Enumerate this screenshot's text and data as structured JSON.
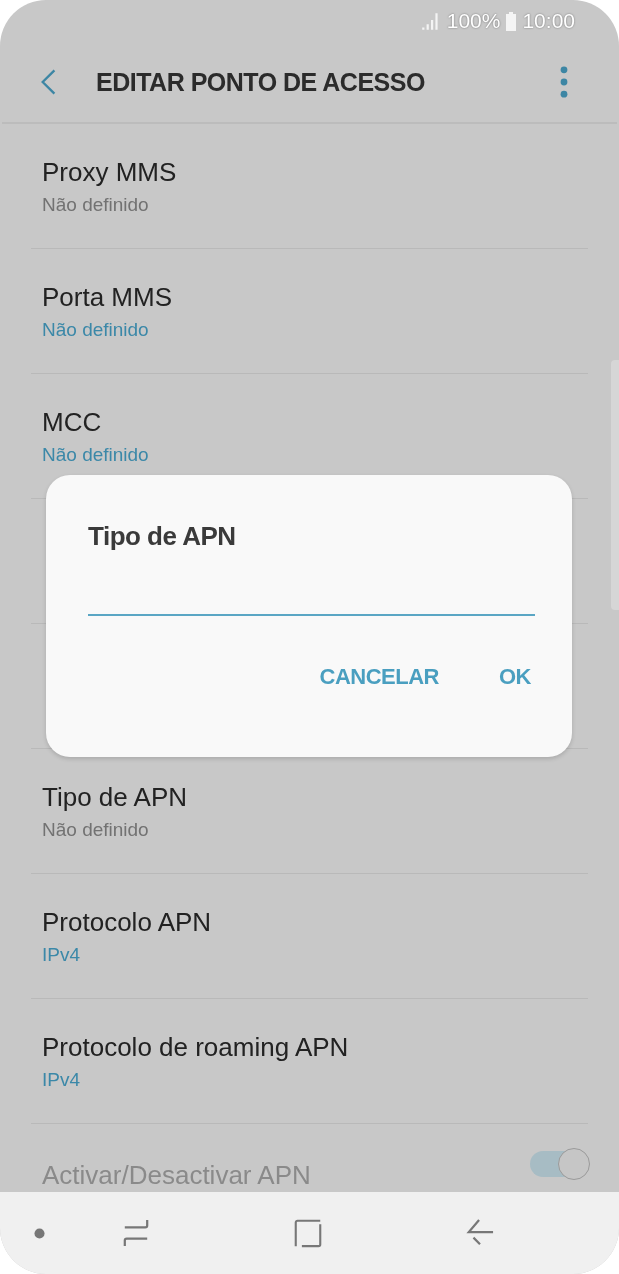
{
  "status_bar": {
    "battery": "100%",
    "time": "10:00"
  },
  "header": {
    "title": "EDITAR PONTO DE ACESSO"
  },
  "settings": [
    {
      "kind": "text",
      "title": "Proxy MMS",
      "value": "Não definido",
      "accent": false
    },
    {
      "kind": "text",
      "title": "Porta MMS",
      "value": "Não definido",
      "accent": true
    },
    {
      "kind": "text",
      "title": "MCC",
      "value": "Não definido",
      "accent": true
    },
    {
      "kind": "covered"
    },
    {
      "kind": "covered"
    },
    {
      "kind": "text",
      "title": "Tipo de APN",
      "value": "Não definido",
      "accent": false
    },
    {
      "kind": "text",
      "title": "Protocolo APN",
      "value": "IPv4",
      "accent": true
    },
    {
      "kind": "text",
      "title": "Protocolo de roaming APN",
      "value": "IPv4",
      "accent": true
    },
    {
      "kind": "toggle",
      "title": "Activar/Desactivar APN",
      "on": true,
      "disabled": true
    }
  ],
  "dialog": {
    "title": "Tipo de APN",
    "buttons": [
      "CANCELAR",
      "OK"
    ]
  }
}
